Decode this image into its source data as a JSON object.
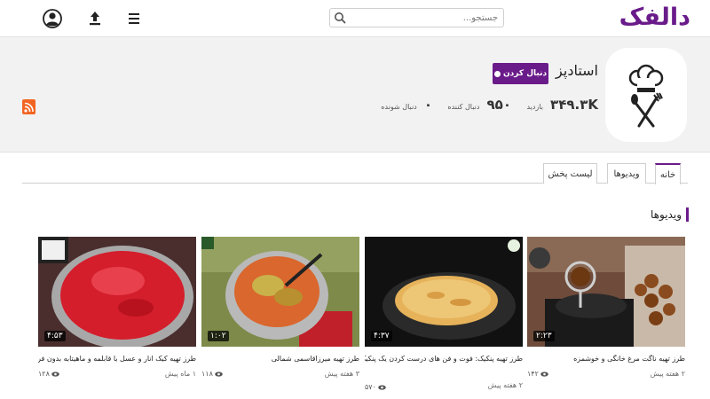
{
  "header": {
    "logo": "دالفک",
    "search_placeholder": "جستجو..."
  },
  "channel": {
    "name": "استادپز",
    "follow_label": "دنبال کردن",
    "stats": [
      {
        "value": "۳۴۹.۳K",
        "label": "بازدید"
      },
      {
        "value": "۹۵۰",
        "label": "دنبال کننده"
      },
      {
        "value": "۰",
        "label": "دنبال شونده"
      }
    ]
  },
  "tabs": [
    {
      "label": "خانه",
      "active": true
    },
    {
      "label": "ویدیوها",
      "active": false
    },
    {
      "label": "لیست پخش",
      "active": false
    }
  ],
  "section": {
    "title": "ویدیوها"
  },
  "videos": [
    {
      "title": "طرز تهیه ناگت مرغ خانگی و خوشمزه",
      "duration": "۲:۲۳",
      "views": "۱۴۲",
      "date": "۲ هفته پیش"
    },
    {
      "title": "طرز تهیه پنکیک: فوت و فن های درست کردن یک پنکیک خو ...",
      "duration": "۴:۳۷",
      "views": "۵۷۰",
      "date": "۲ هفته پیش"
    },
    {
      "title": "طرز تهیه میرزاقاسمی شمالی",
      "duration": "۱:۰۲",
      "views": "۱۱۸",
      "date": "۳ هفته پیش"
    },
    {
      "title": "طرز تهیه کیک انار و عسل با قابلمه و ماهیتابه بدون فر ...",
      "duration": "۴:۵۳",
      "views": "۱۲۸",
      "date": "۱ ماه پیش"
    }
  ]
}
